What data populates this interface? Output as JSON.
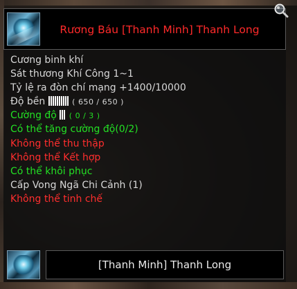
{
  "item": {
    "title": "Rương Báu [Thanh Minh] Thanh Long",
    "title_color": "#ff2a2a",
    "icon": "dragon-chest-icon"
  },
  "attributes": [
    {
      "text": "Cương binh khí",
      "color": "white"
    },
    {
      "text": "Sát thương Khí Công 1~1",
      "color": "white"
    },
    {
      "text": "Tỷ lệ ra đòn chí mạng +1400/10000",
      "color": "white"
    },
    {
      "text": "Độ bền",
      "color": "white",
      "bar_segments": 10,
      "value": "( 650 / 650 )"
    },
    {
      "text": "Cường độ",
      "color": "green",
      "bar_segments": 3,
      "value": "( 0 / 3 )"
    },
    {
      "text": "Có thể tăng cường độ(0/2)",
      "color": "green"
    },
    {
      "text": "Không thể thu thập",
      "color": "red"
    },
    {
      "text": "Không thể Kết hợp",
      "color": "red"
    },
    {
      "text": "Có thể khôi phục",
      "color": "green"
    },
    {
      "text": "Cấp Vong Ngã Chi Cảnh (1)",
      "color": "white"
    },
    {
      "text": "Không thể tinh chế",
      "color": "red"
    }
  ],
  "footer": {
    "name": "[Thanh Minh] Thanh Long",
    "icon": "dragon-portrait-icon"
  },
  "colors": {
    "white": "#d8d8d8",
    "green": "#23e024",
    "red": "#ff2e2e"
  },
  "magnifier_icon": "magnifier-icon"
}
